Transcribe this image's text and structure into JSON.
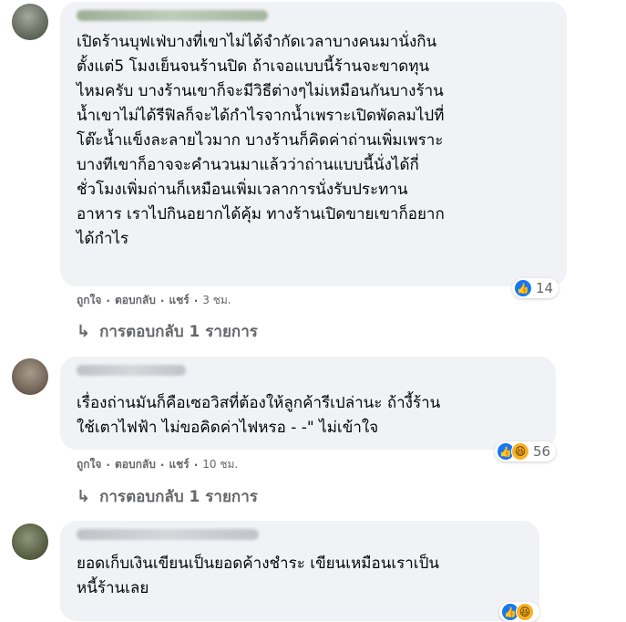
{
  "comments": [
    {
      "text": "เปิดร้านบุฟเฟ่บางที่เขาไม่ได้จำกัดเวลาบางคนมานั่งกิน\nตั้งแต่5 โมงเย็นจนร้านปิด ถ้าเจอแบบนี้ร้านจะขาดทุน\nไหมครับ บางร้านเขาก็จะมีวิธีต่างๆไม่เหมือนกันบางร้าน\nน้ำเขาไม่ได้รีฟิลก็จะได้กำไรจากน้ำเพราะเปิดพัดลมไปที่\nโต๊ะน้ำแข็งละลายไวมาก บางร้านก็คิดค่าถ่านเพิ่มเพราะ\nบางทีเขาก็อาจจะคำนวนมาแล้วว่าถ่านแบบนี้นั่งได้กี่\nชั่วโมงเพิ่มถ่านก็เหมือนเพิ่มเวลาการนั่งรับประทาน\nอาหาร เราไปกินอยากได้คุ้ม ทางร้านเปิดขายเขาก็อยาก\nได้กำไร",
      "like": "ถูกใจ",
      "reply": "ตอบกลับ",
      "share": "แชร์",
      "time": "3 ชม.",
      "reaction_count": "14",
      "reply_link": "การตอบกลับ 1 รายการ"
    },
    {
      "text": "เรื่องถ่านมันก็คือเซอวิสที่ต้องให้ลูกค้ารีเปล่านะ ถ้างี้ร้าน\nใช้เตาไฟฟ้า ไม่ขอคิดค่าไฟหรอ - -\" ไม่เข้าใจ",
      "like": "ถูกใจ",
      "reply": "ตอบกลับ",
      "share": "แชร์",
      "time": "10 ชม.",
      "reaction_count": "56",
      "reply_link": "การตอบกลับ 1 รายการ"
    },
    {
      "text": "ยอดเก็บเงินเขียนเป็นยอดค้างชำระ เขียนเหมือนเราเป็น\nหนี้ร้านเลย"
    }
  ],
  "separator": "·",
  "icons": {
    "like": "like-icon",
    "haha": "haha-icon",
    "reply_arrow": "reply-arrow-icon"
  },
  "colors": {
    "bubble": "#f0f2f5",
    "meta": "#65676b",
    "like_blue": "#1877f2"
  }
}
